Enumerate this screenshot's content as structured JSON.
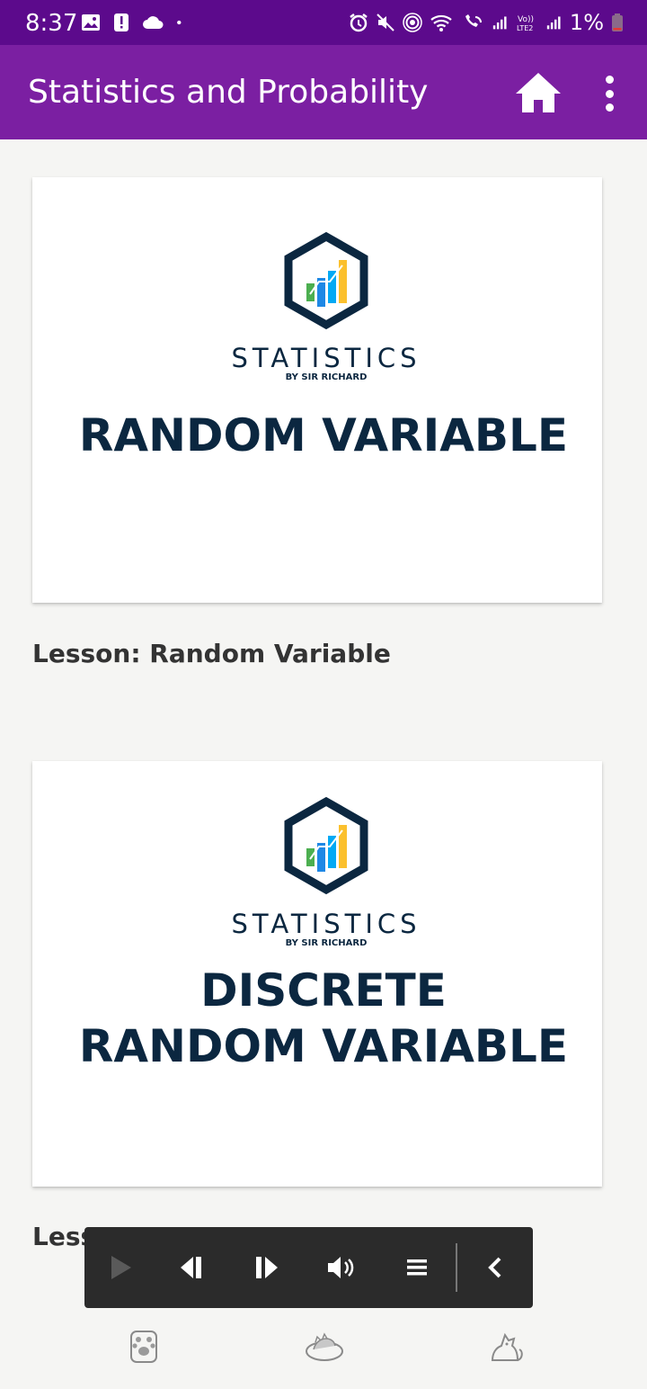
{
  "status_bar": {
    "time": "8:37",
    "battery": "1%"
  },
  "app_bar": {
    "title": "Statistics and Probability",
    "home_icon": "home-icon",
    "more_icon": "more-vert-icon"
  },
  "lessons": [
    {
      "brand": "STATISTICS",
      "brand_sub": "BY SIR RICHARD",
      "title_lines": [
        "RANDOM VARIABLE"
      ],
      "caption": "Lesson: Random Variable"
    },
    {
      "brand": "STATISTICS",
      "brand_sub": "BY SIR RICHARD",
      "title_lines": [
        "DISCRETE",
        "RANDOM VARIABLE"
      ],
      "caption": "Less"
    }
  ],
  "media_controls": [
    "play-icon",
    "previous-icon",
    "next-icon",
    "volume-icon",
    "menu-icon",
    "collapse-icon"
  ],
  "bottom_nav": [
    "paw-icon",
    "cat-bed-icon",
    "cat-icon"
  ],
  "colors": {
    "status_bar": "#5c0a8c",
    "app_bar": "#7b1fa2",
    "title_navy": "#0b2740",
    "background": "#f5f5f3"
  }
}
